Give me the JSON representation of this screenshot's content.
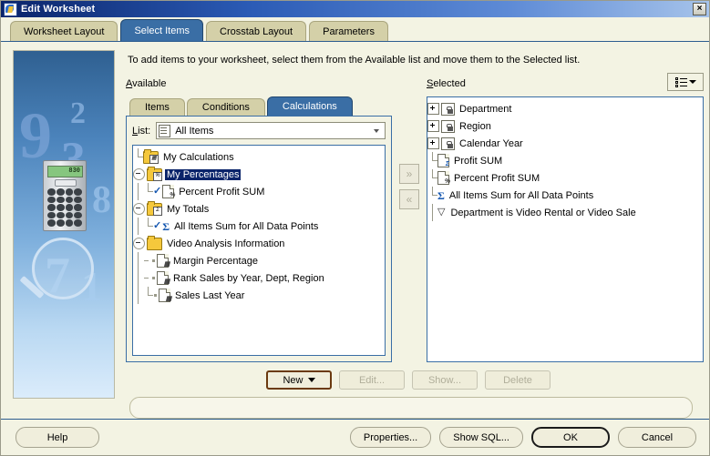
{
  "window": {
    "title": "Edit Worksheet",
    "close_label": "×",
    "app_icon": "worksheet-icon"
  },
  "tabs": [
    {
      "label": "Worksheet Layout",
      "active": false
    },
    {
      "label": "Select Items",
      "active": true
    },
    {
      "label": "Crosstab Layout",
      "active": false
    },
    {
      "label": "Parameters",
      "active": false
    }
  ],
  "intro": "To add items to your worksheet, select them from the Available list and move them to the Selected list.",
  "available": {
    "label": "Available",
    "accel": "A",
    "subtabs": [
      {
        "label": "Items",
        "active": false
      },
      {
        "label": "Conditions",
        "active": false
      },
      {
        "label": "Calculations",
        "active": true
      }
    ],
    "list_label": "List:",
    "list_accel": "L",
    "list_value": "All Items",
    "tree": [
      {
        "label": "My Calculations",
        "kind": "folder",
        "badge": "calculator-badge",
        "depth": 0,
        "toggle": "none",
        "selected": false
      },
      {
        "label": "My Percentages",
        "kind": "folder",
        "badge": "percent-badge",
        "depth": 0,
        "toggle": "collapse",
        "selected": true
      },
      {
        "label": "Percent Profit SUM",
        "kind": "doc-percent",
        "check": true,
        "depth": 1,
        "toggle": "none",
        "selected": false
      },
      {
        "label": "My Totals",
        "kind": "folder",
        "badge": "sigma-badge",
        "depth": 0,
        "toggle": "collapse",
        "selected": false
      },
      {
        "label": "All Items Sum for All Data Points",
        "kind": "sigma",
        "check": true,
        "depth": 1,
        "toggle": "none",
        "selected": false
      },
      {
        "label": "Video Analysis Information",
        "kind": "folder-open",
        "badge": "",
        "depth": 0,
        "toggle": "collapse",
        "selected": false
      },
      {
        "label": "Margin Percentage",
        "kind": "doc-grid",
        "check": false,
        "depth": 1,
        "toggle": "none",
        "selected": false
      },
      {
        "label": "Rank Sales by Year, Dept, Region",
        "kind": "doc-grid",
        "check": false,
        "depth": 1,
        "toggle": "none",
        "selected": false
      },
      {
        "label": "Sales Last Year",
        "kind": "doc-grid",
        "check": false,
        "depth": 1,
        "toggle": "none",
        "selected": false
      }
    ]
  },
  "mover": {
    "add_label": "»",
    "remove_label": "«"
  },
  "selected": {
    "label": "Selected",
    "accel": "S",
    "view_button": "list-view-button",
    "tree": [
      {
        "label": "Department",
        "kind": "lock",
        "toggle": "expand"
      },
      {
        "label": "Region",
        "kind": "lock",
        "toggle": "expand"
      },
      {
        "label": "Calendar Year",
        "kind": "lock",
        "toggle": "expand"
      },
      {
        "label": "Profit SUM",
        "kind": "doc-sigma",
        "toggle": "none"
      },
      {
        "label": "Percent Profit SUM",
        "kind": "doc-percent",
        "toggle": "none"
      },
      {
        "label": "All Items Sum for All Data Points",
        "kind": "sigma",
        "toggle": "none"
      },
      {
        "label": "Department is Video Rental or Video Sale",
        "kind": "funnel",
        "toggle": "none"
      }
    ]
  },
  "actions": [
    {
      "label": "New",
      "accel": "w",
      "state": "primary",
      "dropdown": true
    },
    {
      "label": "Edit...",
      "accel": "E",
      "state": "disabled",
      "dropdown": false
    },
    {
      "label": "Show...",
      "accel": "S",
      "state": "disabled",
      "dropdown": false
    },
    {
      "label": "Delete",
      "accel": "D",
      "state": "disabled",
      "dropdown": false
    }
  ],
  "status_text": "",
  "footer": {
    "help": "Help",
    "properties": "Properties...",
    "show_sql": "Show SQL...",
    "ok": "OK",
    "cancel": "Cancel"
  },
  "colors": {
    "titlebar_start": "#0a246a",
    "titlebar_end": "#a6c3ea",
    "tab_inactive": "#d4d0a8",
    "tab_active": "#3a6ea5",
    "dialog_bg": "#f3f3e3",
    "selection": "#0a246a",
    "panel_border": "#3a6ea5"
  },
  "calculator": {
    "display": "830"
  }
}
